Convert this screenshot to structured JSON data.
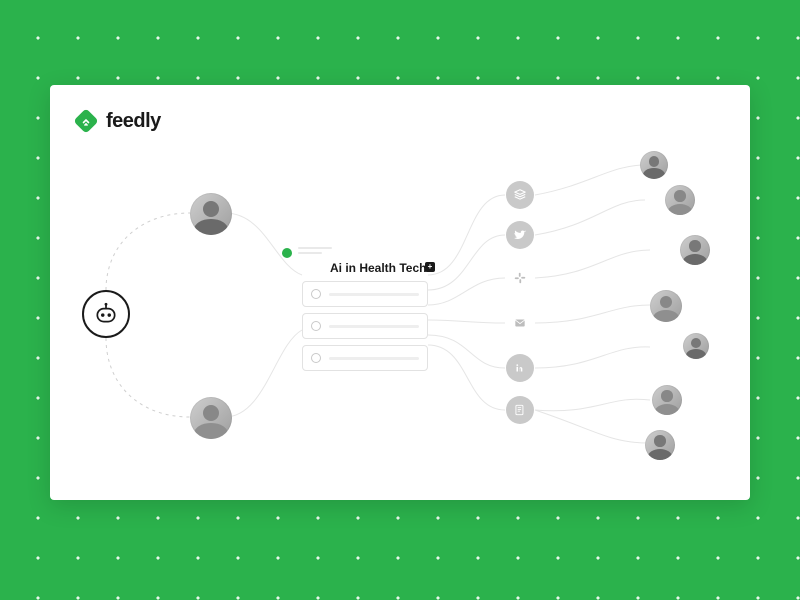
{
  "brand": {
    "name": "feedly",
    "accent": "#2BB24C"
  },
  "board": {
    "title": "Ai in Health Tech",
    "badge_symbol": "+",
    "articles": 3
  },
  "input": {
    "robot_label": "leo-ai",
    "curators": [
      "curator-1",
      "curator-2"
    ]
  },
  "outputs": {
    "channels": [
      "buffer",
      "twitter",
      "slack",
      "email",
      "linkedin",
      "newsletter"
    ]
  },
  "audience": {
    "people": [
      "reader-1",
      "reader-2",
      "reader-3",
      "reader-4",
      "reader-5",
      "reader-6",
      "reader-7"
    ]
  }
}
